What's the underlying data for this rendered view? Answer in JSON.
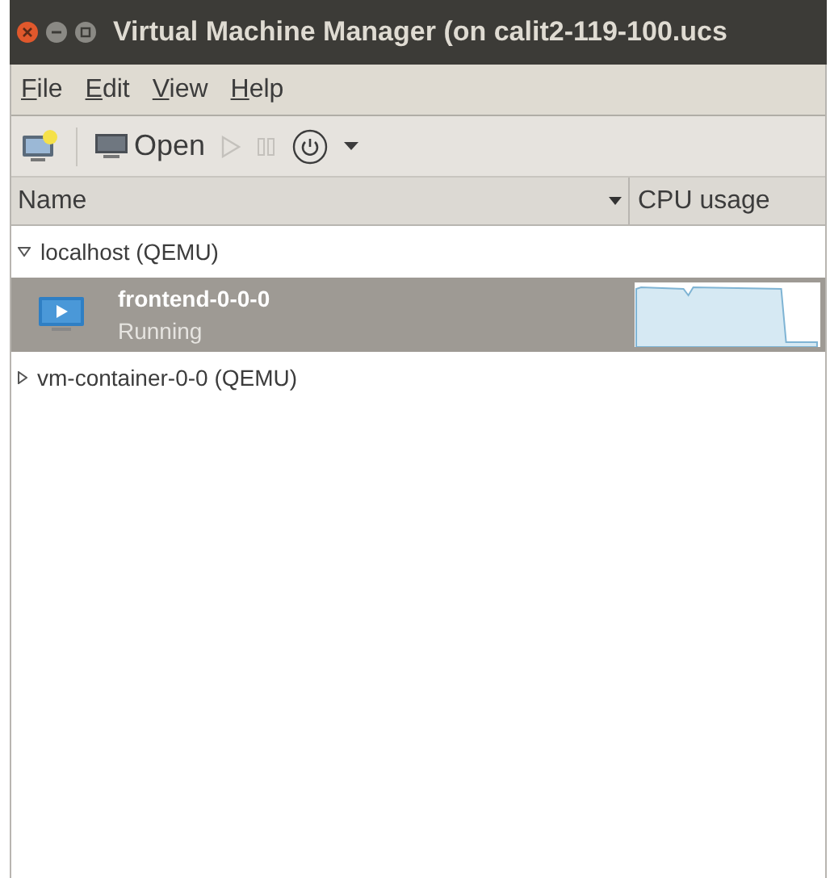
{
  "window": {
    "title": "Virtual Machine Manager (on calit2-119-100.ucs"
  },
  "menu": [
    {
      "label": "File"
    },
    {
      "label": "Edit"
    },
    {
      "label": "View"
    },
    {
      "label": "Help"
    }
  ],
  "toolbar": [
    {
      "kind": "new",
      "disabled": false
    },
    {
      "kind": "open",
      "label": "Open",
      "disabled": false
    },
    {
      "kind": "run",
      "disabled": true
    },
    {
      "kind": "pause",
      "disabled": true
    },
    {
      "kind": "shutdown",
      "disabled": false
    },
    {
      "kind": "dropdown",
      "disabled": false
    }
  ],
  "table": {
    "columns": [
      "Name",
      "CPU usage"
    ],
    "connections": [
      {
        "name": "localhost (QEMU)",
        "expanded": true,
        "selected": false,
        "children": [
          {
            "name": "frontend-0-0-0",
            "status": "Running",
            "selected": true
          }
        ]
      },
      {
        "name": "vm-container-0-0 (QEMU)",
        "expanded": false,
        "selected": false
      }
    ]
  }
}
